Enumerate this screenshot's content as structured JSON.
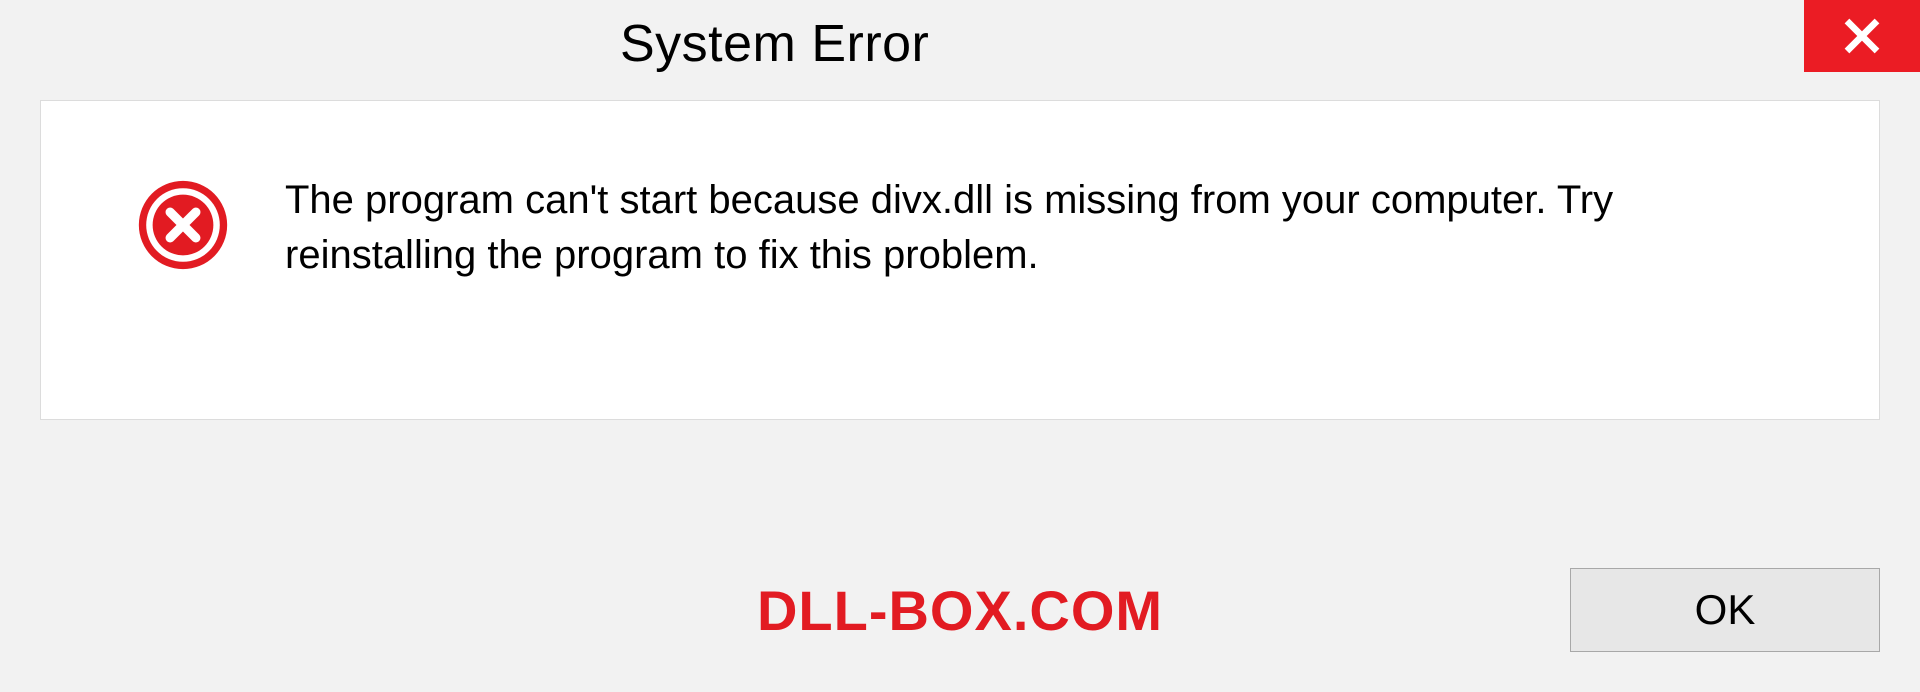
{
  "titlebar": {
    "title": "System Error"
  },
  "content": {
    "message": "The program can't start because divx.dll is missing from your computer. Try reinstalling the program to fix this problem."
  },
  "footer": {
    "watermark": "DLL-BOX.COM",
    "ok_label": "OK"
  },
  "colors": {
    "close_bg": "#eb1c24",
    "error_icon": "#e21b22",
    "watermark": "#e21b22"
  }
}
